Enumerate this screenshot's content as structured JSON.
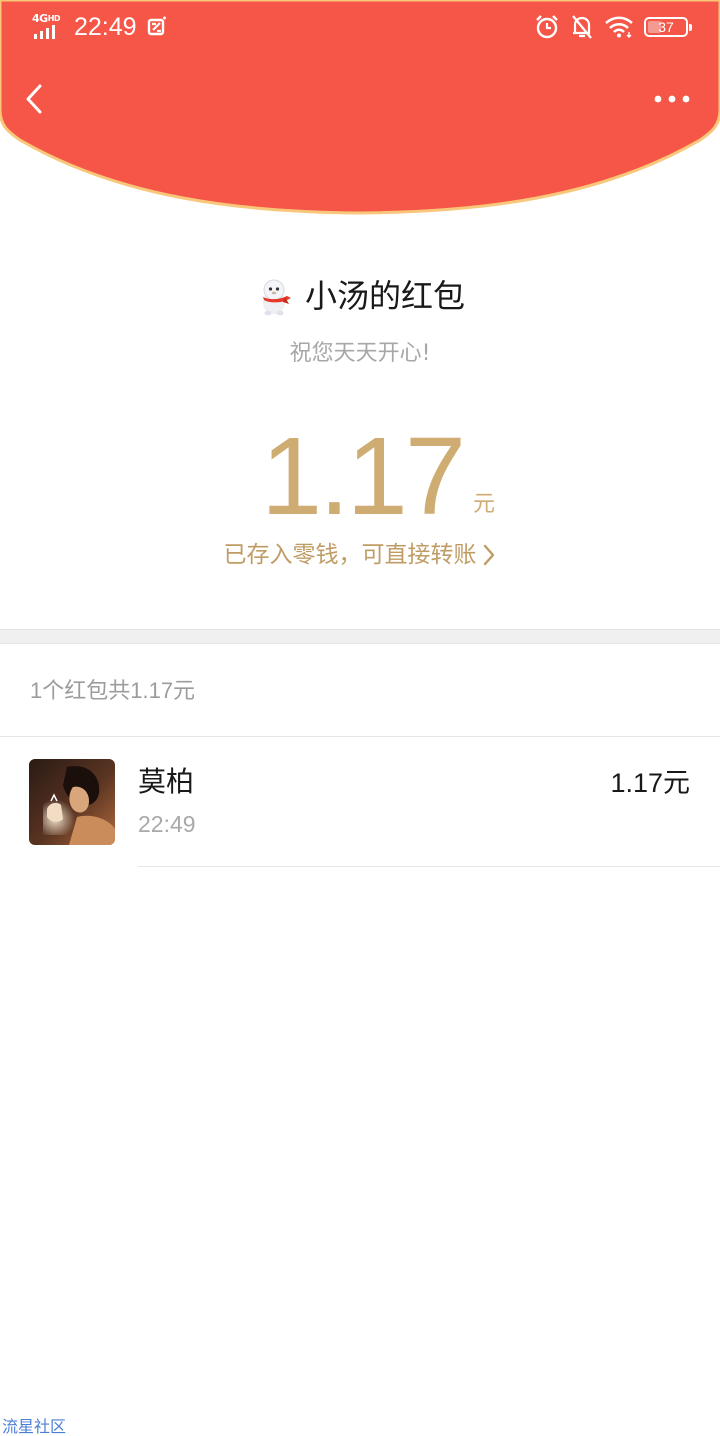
{
  "status_bar": {
    "network": "4G",
    "network_badge": "HD",
    "time": "22:49",
    "battery_level": "37",
    "battery_fraction": 0.37
  },
  "nav": {
    "back_icon": "chevron-left-icon",
    "more_icon": "more-dots-icon"
  },
  "colors": {
    "banner_red": "#f55647",
    "banner_edge": "#f8c77a",
    "gold": "#cfac72",
    "link_gold": "#c09c65"
  },
  "red_packet": {
    "sender_title": "小汤的红包",
    "blessing": "祝您天天开心!",
    "amount": "1.17",
    "unit": "元",
    "saved_link": "已存入零钱，可直接转账"
  },
  "summary": {
    "text": "1个红包共1.17元"
  },
  "receivers": [
    {
      "name": "莫柏",
      "time": "22:49",
      "amount": "1.17元"
    }
  ],
  "watermark": "流星社区"
}
